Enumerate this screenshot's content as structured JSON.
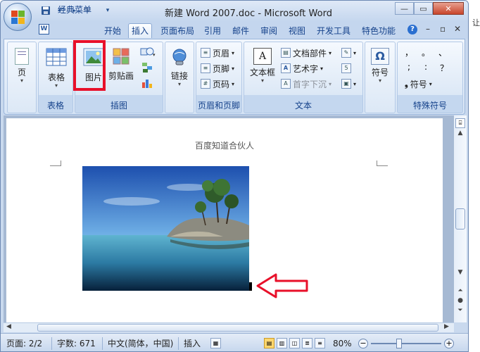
{
  "window": {
    "title": "新建 Word 2007.doc - Microsoft Word"
  },
  "qat": {
    "save": "save-icon",
    "undo": "↶",
    "redo": "↷",
    "customize": "▾"
  },
  "tabs": [
    "经典菜单",
    "开始",
    "插入",
    "页面布局",
    "引用",
    "邮件",
    "审阅",
    "视图",
    "开发工具",
    "特色功能"
  ],
  "ribbon": {
    "pages_label": "页",
    "table_label": "表格",
    "picture_label": "图片",
    "clipart_label": "剪贴画",
    "link_label": "链接",
    "header_label": "页眉",
    "footer_label": "页脚",
    "pagenum_label": "页码",
    "textbox_label": "文本框",
    "quickparts_label": "文档部件",
    "wordart_label": "艺术字",
    "dropcap_label": "首字下沉",
    "symbol_label": "符号",
    "symbol2_label": "符号",
    "special_marks": [
      "，",
      "。",
      "、",
      ";",
      ":",
      "？"
    ],
    "groups": {
      "tables": "表格",
      "illustrations": "插图",
      "headerfooter": "页眉和页脚",
      "text": "文本",
      "special": "特殊符号"
    }
  },
  "document": {
    "header_text": "百度知道合伙人"
  },
  "status": {
    "page": "页面: 2/2",
    "words": "字数: 671",
    "language": "中文(简体，中国)",
    "mode": "插入",
    "zoom": "80%"
  },
  "outside_char": "让",
  "colors": {
    "accent": "#15428b",
    "highlight": "#e8102a"
  }
}
